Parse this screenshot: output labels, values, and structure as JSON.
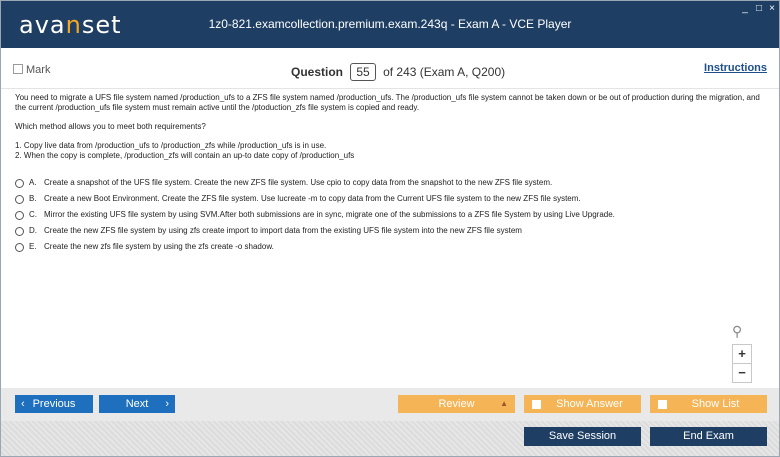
{
  "app": {
    "logo_pre": "ava",
    "logo_accent": "n",
    "logo_post": "set",
    "window_title": "1z0-821.examcollection.premium.exam.243q - Exam A - VCE Player",
    "window_controls": {
      "minimize": "_",
      "maximize": "□",
      "close": "×"
    }
  },
  "question_bar": {
    "mark_label": "Mark",
    "question_label": "Question",
    "question_number": "55",
    "total_text": "of 243 (Exam A, Q200)",
    "instructions_label": "Instructions"
  },
  "question": {
    "text": "You need to migrate a UFS file system named /production_ufs to a ZFS file system named /production_ufs. The /production_ufs file system cannot be taken down or be out of production during the migration, and the current /production_ufs file system must remain active until the /ptoduction_zfs file system is copied and ready.",
    "prompt": "Which method allows you to meet both requirements?",
    "requirements": [
      "1. Copy live data from /production_ufs to /production_zfs while /production_ufs is in use.",
      "2. When the copy is complete, /production_zfs will contain an up-to date copy of /production_ufs"
    ],
    "options": [
      {
        "letter": "A.",
        "text": "Create a snapshot of the UFS file system. Create the new ZFS file system. Use cpio to copy data from the snapshot to the new ZFS file system."
      },
      {
        "letter": "B.",
        "text": "Create a new Boot Environment. Create the ZFS file system. Use lucreate -m to copy data from the Current UFS file system to the new ZFS file system."
      },
      {
        "letter": "C.",
        "text": "Mirror the existing UFS file system by using SVM.After both submissions are in sync, migrate one of the submissions to a ZFS file System by using Live Upgrade."
      },
      {
        "letter": "D.",
        "text": "Create the new ZFS file system by using zfs create import to import data from the existing UFS file system into the new ZFS file system"
      },
      {
        "letter": "E.",
        "text": "Create the new zfs file system by using the zfs create -o shadow."
      }
    ]
  },
  "zoom": {
    "search_icon": "⚲",
    "zoom_in": "+",
    "zoom_out": "−"
  },
  "nav": {
    "previous_label": "Previous",
    "next_label": "Next",
    "review_label": "Review",
    "show_answer_label": "Show Answer",
    "show_list_label": "Show List",
    "chevron_left": "‹",
    "chevron_right": "›",
    "review_arrow": "▲"
  },
  "footer": {
    "save_session_label": "Save Session",
    "end_exam_label": "End Exam"
  },
  "colors": {
    "titlebar": "#1e3f63",
    "accent_orange": "#f5a623",
    "nav_blue": "#1e6fbe",
    "option_orange": "#f5b455"
  }
}
